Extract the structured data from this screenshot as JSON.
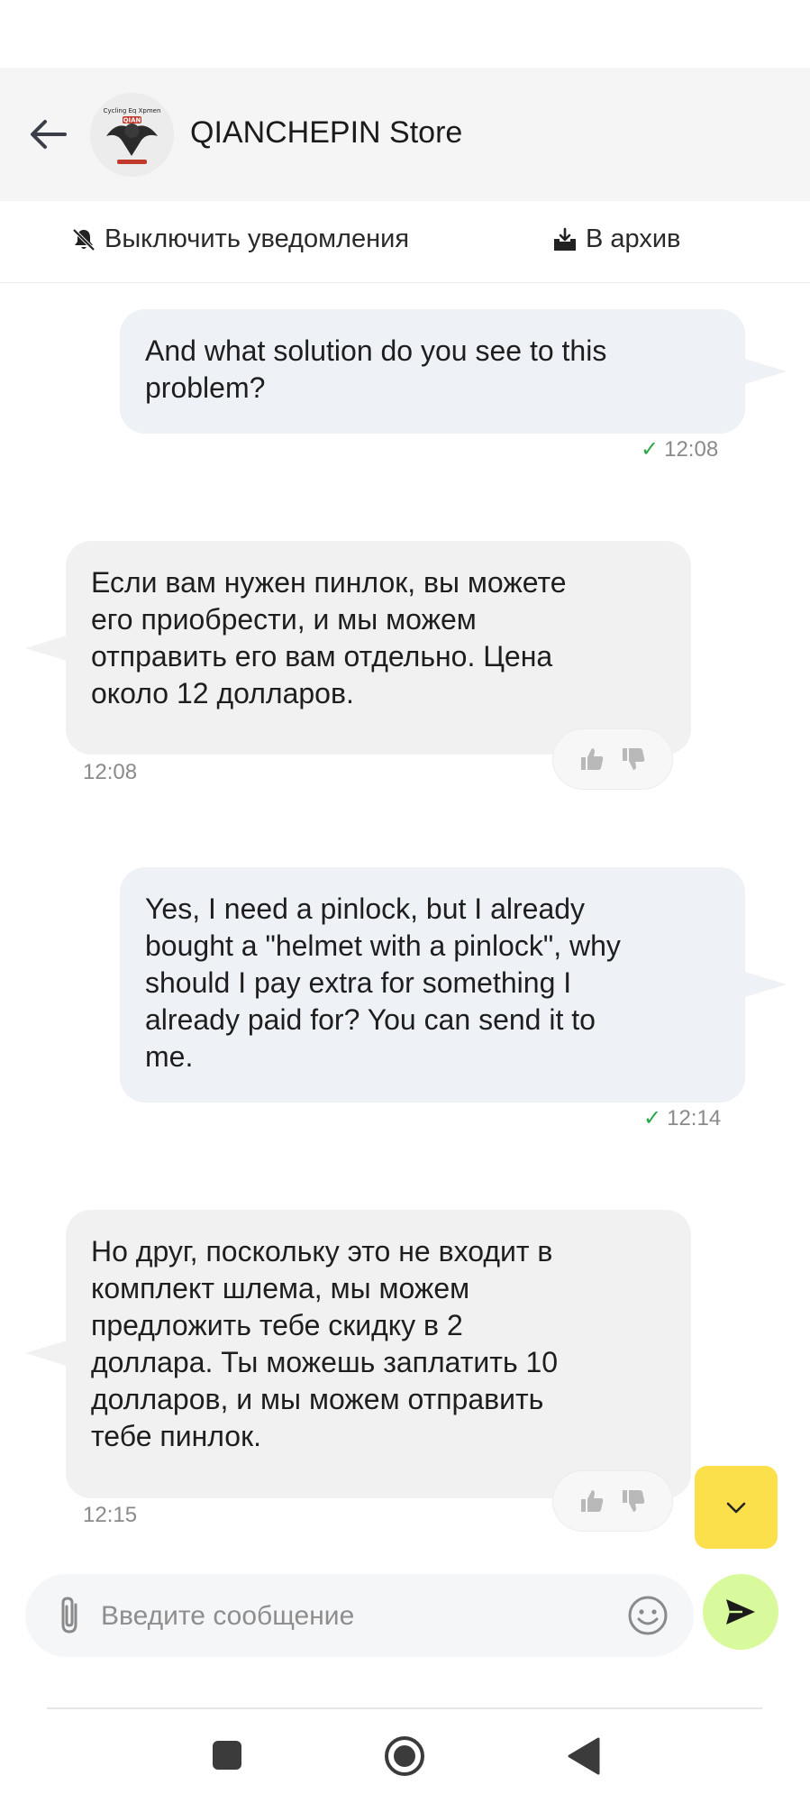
{
  "header": {
    "store_name": "QIANCHEPIN Store",
    "back_icon": "arrow-left-icon",
    "avatar_text_top": "Cycling Eq Xpmen",
    "avatar_brand": "QIAN"
  },
  "actions": {
    "mute_label": "Выключить уведомления",
    "archive_label": "В архив"
  },
  "messages": [
    {
      "dir": "out",
      "lines": [
        "And what solution do you see to this",
        "problem?"
      ],
      "time": "12:08",
      "status": "read"
    },
    {
      "dir": "in",
      "lines": [
        "Если вам нужен пинлок, вы можете",
        "его приобрести, и мы можем",
        "отправить его вам отдельно. Цена",
        "около 12 долларов."
      ],
      "time": "12:08"
    },
    {
      "dir": "out",
      "lines": [
        "Yes, I need a pinlock, but I already",
        "bought a \"helmet with a pinlock\", why",
        "should I pay extra for something I",
        "already paid for? You can send it to",
        "me."
      ],
      "time": "12:14",
      "status": "read"
    },
    {
      "dir": "in",
      "lines": [
        "Но друг, поскольку это не входит в",
        "комплект шлема, мы можем",
        "предложить тебе скидку в 2",
        "доллара. Ты можешь заплатить 10",
        "долларов, и мы можем отправить",
        "тебе пинлок."
      ],
      "time": "12:15"
    }
  ],
  "composer": {
    "placeholder": "Введите сообщение",
    "value": ""
  },
  "colors": {
    "accent_yellow": "#fbe04b",
    "send_green": "#d9f99d",
    "check_green": "#29a847",
    "bubble_out": "#eef1f6",
    "bubble_in": "#f1f1f1"
  }
}
